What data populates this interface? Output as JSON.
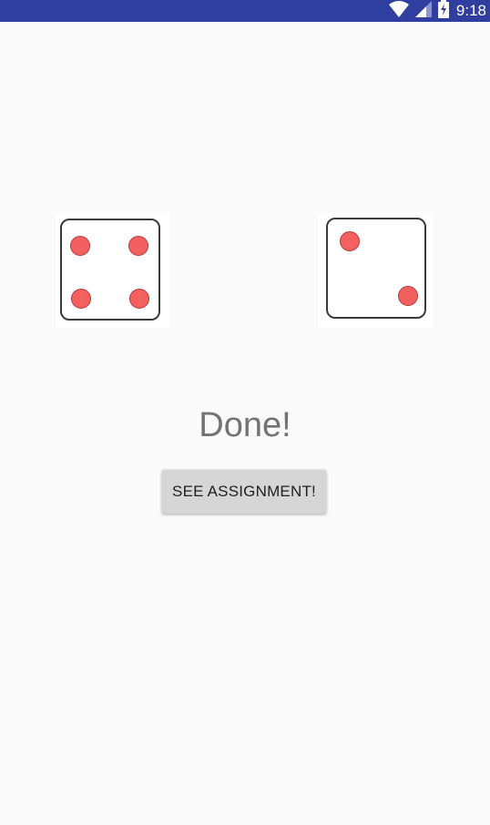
{
  "status_bar": {
    "time": "9:18",
    "background": "#303f9f",
    "icons": [
      "wifi-icon",
      "signal-icon",
      "battery-charging-icon"
    ]
  },
  "dice": {
    "left": {
      "value": 4
    },
    "right": {
      "value": 2
    },
    "pip_color": "#f26060",
    "border_color": "#3a3a3a"
  },
  "result": {
    "text": "Done!",
    "color": "#737373"
  },
  "actions": {
    "see_assignment_label": "SEE ASSIGNMENT!"
  }
}
